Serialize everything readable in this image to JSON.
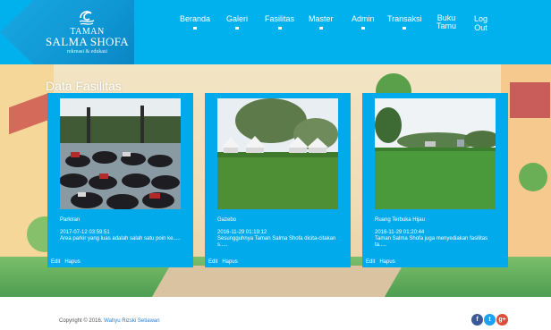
{
  "header": {
    "logo": {
      "line1": "TAMAN",
      "line2": "SALMA SHOFA",
      "line3": "rekreasi & edukasi"
    },
    "nav": [
      "Beranda",
      "Galeri",
      "Fasilitas",
      "Master",
      "Admin",
      "Transaksi",
      "Buku\nTamu",
      "Log Out"
    ]
  },
  "colors": {
    "header_bg": "#00b1ee",
    "card_bg": "#00aaeb",
    "author_link": "#2a7fd1",
    "facebook": "#3b5998",
    "twitter": "#1da1f2",
    "google_plus": "#dd4b39"
  },
  "page": {
    "title": "Data Fasilitas"
  },
  "cards": [
    {
      "name": "Parkiran",
      "date": "2017-07-12 03:59:51",
      "desc": "Area parkir yang luas adalah salah satu poin ke.....",
      "edit": "Edit",
      "delete": "Hapus"
    },
    {
      "name": "Gazebo",
      "date": "2016-11-29 01:19:12",
      "desc": "Sesungguhnya Taman Salma Shofa dicita-citakan s.....",
      "edit": "Edit",
      "delete": "Hapus"
    },
    {
      "name": "Ruang Terbuka Hijau",
      "date": "2016-11-29 01:20:44",
      "desc": "Taman Salma Shofa juga menyediakan fasilitas ta.....",
      "edit": "Edit",
      "delete": "Hapus"
    }
  ],
  "footer": {
    "copyright": "Copyright © 2016.",
    "author": "Wahyu Rizski Setiawan"
  },
  "social": [
    {
      "icon": "facebook-icon",
      "glyph": "f"
    },
    {
      "icon": "twitter-icon",
      "glyph": "t"
    },
    {
      "icon": "google-plus-icon",
      "glyph": "g+"
    }
  ]
}
